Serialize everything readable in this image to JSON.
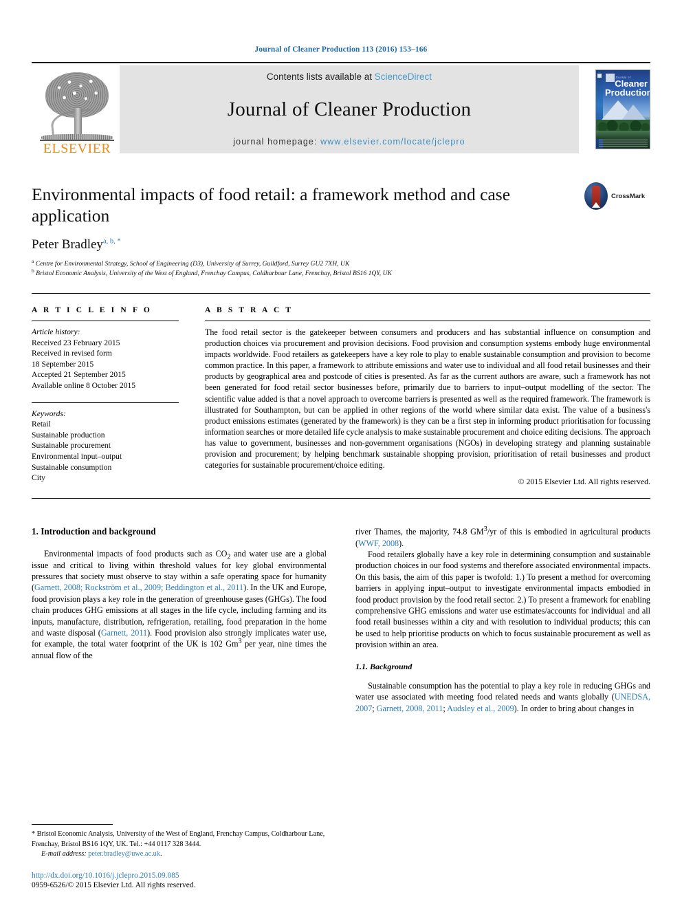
{
  "running_head": "Journal of Cleaner Production 113 (2016) 153–166",
  "masthead": {
    "contents_prefix": "Contents lists available at",
    "sciencedirect": "ScienceDirect",
    "journal_title": "Journal of Cleaner Production",
    "homepage_prefix": "journal homepage:",
    "homepage_url": "www.elsevier.com/locate/jclepro",
    "publisher": "ELSEVIER",
    "publisher_color": "#f08a1b",
    "link_color": "#3c8dbc",
    "band_color": "#e3e3e3",
    "cover": {
      "overline": "Journal of",
      "line1": "Cleaner",
      "line2": "Production"
    }
  },
  "article": {
    "title": "Environmental impacts of food retail: a framework method and case application",
    "author": "Peter Bradley",
    "author_marks": "a, b, *",
    "crossmark_label": "CrossMark",
    "affiliations": [
      {
        "mark": "a",
        "text": "Centre for Environmental Strategy, School of Engineering (D3), University of Surrey, Guildford, Surrey GU2 7XH, UK"
      },
      {
        "mark": "b",
        "text": "Bristol Economic Analysis, University of the West of England, Frenchay Campus, Coldharbour Lane, Frenchay, Bristol BS16 1QY, UK"
      }
    ]
  },
  "info": {
    "heading": "A R T I C L E  I N F O",
    "history_title": "Article history:",
    "history": [
      "Received 23 February 2015",
      "Received in revised form",
      "18 September 2015",
      "Accepted 21 September 2015",
      "Available online 8 October 2015"
    ],
    "keywords_title": "Keywords:",
    "keywords": [
      "Retail",
      "Sustainable production",
      "Sustainable procurement",
      "Environmental input–output",
      "Sustainable consumption",
      "City"
    ]
  },
  "abstract": {
    "heading": "A B S T R A C T",
    "text": "The food retail sector is the gatekeeper between consumers and producers and has substantial influence on consumption and production choices via procurement and provision decisions. Food provision and consumption systems embody huge environmental impacts worldwide. Food retailers as gatekeepers have a key role to play to enable sustainable consumption and provision to become common practice. In this paper, a framework to attribute emissions and water use to individual and all food retail businesses and their products by geographical area and postcode of cities is presented. As far as the current authors are aware, such a framework has not been generated for food retail sector businesses before, primarily due to barriers to input–output modelling of the sector. The scientific value added is that a novel approach to overcome barriers is presented as well as the required framework. The framework is illustrated for Southampton, but can be applied in other regions of the world where similar data exist. The value of a business's product emissions estimates (generated by the framework) is they can be a first step in informing product prioritisation for focussing information searches or more detailed life cycle analysis to make sustainable procurement and choice editing decisions. The approach has value to government, businesses and non-government organisations (NGOs) in developing strategy and planning sustainable provision and procurement; by helping benchmark sustainable shopping provision, prioritisation of retail businesses and product categories for sustainable procurement/choice editing.",
    "copyright": "© 2015 Elsevier Ltd. All rights reserved."
  },
  "body": {
    "section1_heading": "1. Introduction and background",
    "left_paragraph_1_a": "Environmental impacts of food products such as CO",
    "left_paragraph_1_sub": "2",
    "left_paragraph_1_b": " and water use are a global issue and critical to living within threshold values for key global environmental pressures that society must observe to stay within a safe operating space for humanity (",
    "cite_1": "Garnett, 2008; Rockström et al., 2009; Beddington et al., 2011",
    "left_paragraph_1_c": "). In the UK and Europe, food provision plays a key role in the generation of greenhouse gases (GHGs). The food chain produces GHG emissions at all stages in the life cycle, including farming and its inputs, manufacture, distribution, refrigeration, retailing, food preparation in the home and waste disposal (",
    "cite_2": "Garnett, 2011",
    "left_paragraph_1_d": "). Food provision also strongly implicates water use, for example, the total water footprint of the UK is 102 Gm",
    "left_paragraph_1_sup": "3",
    "left_paragraph_1_e": " per year, nine times the annual flow of the",
    "right_paragraph_1_a": "river Thames, the majority, 74.8 GM",
    "right_paragraph_1_sup": "3",
    "right_paragraph_1_b": "/yr of this is embodied in agricultural products (",
    "cite_3": "WWF, 2008",
    "right_paragraph_1_c": ").",
    "right_paragraph_2": "Food retailers globally have a key role in determining consumption and sustainable production choices in our food systems and therefore associated environmental impacts. On this basis, the aim of this paper is twofold: 1.) To present a method for overcoming barriers in applying input–output to investigate environmental impacts embodied in food product provision by the food retail sector. 2.) To present a framework for enabling comprehensive GHG emissions and water use estimates/accounts for individual and all food retail businesses within a city and with resolution to individual products; this can be used to help prioritise products on which to focus sustainable procurement as well as provision within an area.",
    "section11_heading": "1.1. Background",
    "right_paragraph_3_a": "Sustainable consumption has the potential to play a key role in reducing GHGs and water use associated with meeting food related needs and wants globally (",
    "cite_4": "UNEDSA, 2007",
    "right_paragraph_3_b": "; ",
    "cite_5": "Garnett, 2008, 2011",
    "right_paragraph_3_c": "; ",
    "cite_6": "Audsley et al., 2009",
    "right_paragraph_3_d": "). In order to bring about changes in"
  },
  "footnote": {
    "star": "*",
    "address": "Bristol Economic Analysis, University of the West of England, Frenchay Campus, Coldharbour Lane, Frenchay, Bristol BS16 1QY, UK. Tel.: +44 0117 328 3444.",
    "email_label": "E-mail address:",
    "email": "peter.bradley@uwe.ac.uk",
    "email_trailer": ".",
    "doi": "http://dx.doi.org/10.1016/j.jclepro.2015.09.085",
    "issn": "0959-6526/© 2015 Elsevier Ltd. All rights reserved."
  }
}
